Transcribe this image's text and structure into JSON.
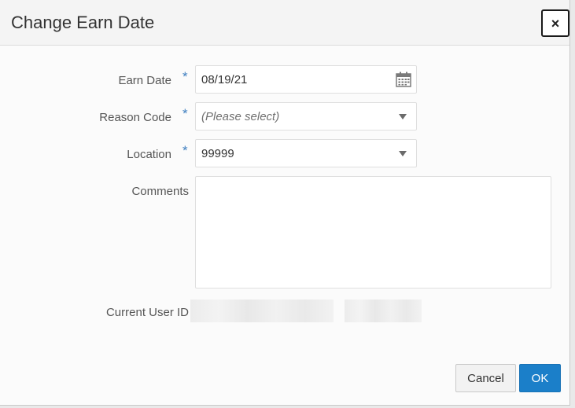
{
  "dialog": {
    "title": "Change Earn Date",
    "close_label": "×"
  },
  "form": {
    "earn_date": {
      "label": "Earn Date",
      "required_mark": "*",
      "value": "08/19/21",
      "icon": "calendar-icon"
    },
    "reason_code": {
      "label": "Reason Code",
      "required_mark": "*",
      "placeholder": "(Please select)"
    },
    "location": {
      "label": "Location",
      "required_mark": "*",
      "value": "99999"
    },
    "comments": {
      "label": "Comments",
      "value": ""
    },
    "current_user_id": {
      "label": "Current User ID"
    }
  },
  "footer": {
    "cancel_label": "Cancel",
    "ok_label": "OK"
  },
  "colors": {
    "accent": "#1b7fc9",
    "required": "#3f7fc0"
  }
}
